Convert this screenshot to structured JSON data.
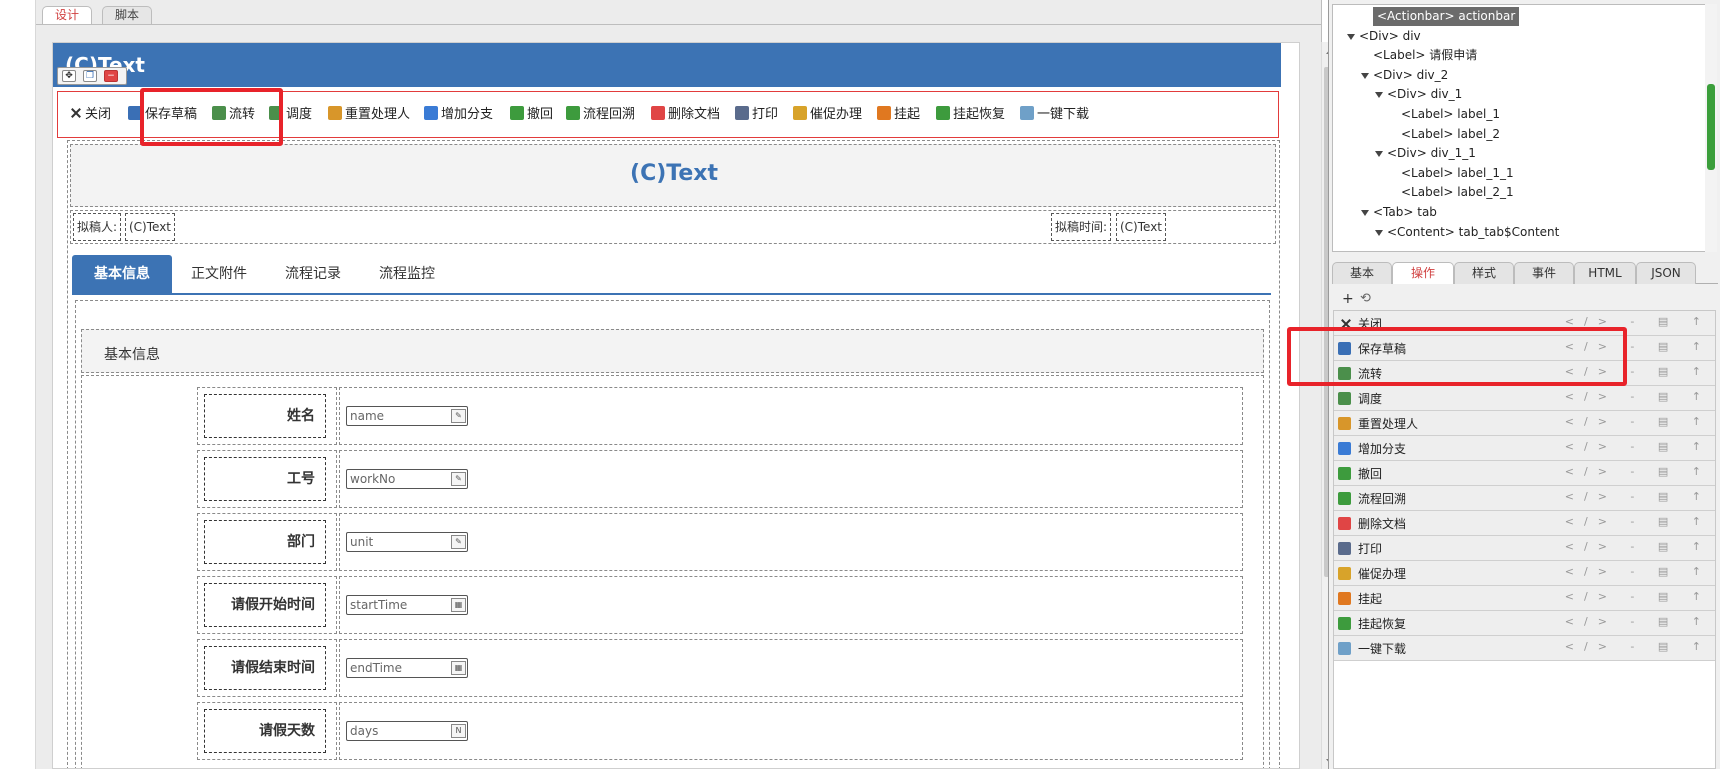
{
  "mode_tabs": {
    "design": "设计",
    "script": "脚本"
  },
  "form": {
    "title": "(C)Text",
    "header_text": "(C)Text",
    "drafter_label": "拟稿人:",
    "drafter_value": "(C)Text",
    "draft_time_label": "拟稿时间:",
    "draft_time_value": "(C)Text",
    "section_title": "基本信息"
  },
  "actionbar": {
    "items": [
      {
        "label": "关闭",
        "icon": "close-x",
        "color": "#333333"
      },
      {
        "label": "保存草稿",
        "icon": "save-draft",
        "color": "#3a6fb5"
      },
      {
        "label": "流转",
        "icon": "flow-transfer",
        "color": "#4b8f4b"
      },
      {
        "label": "调度",
        "icon": "dispatch",
        "color": "#4b8f4b"
      },
      {
        "label": "重置处理人",
        "icon": "reset-user",
        "color": "#d8962a"
      },
      {
        "label": "增加分支",
        "icon": "add-branch",
        "color": "#3a7bd5"
      },
      {
        "label": "撤回",
        "icon": "withdraw",
        "color": "#3d9b3d"
      },
      {
        "label": "流程回溯",
        "icon": "flow-trace",
        "color": "#3d9b3d"
      },
      {
        "label": "删除文档",
        "icon": "delete-doc",
        "color": "#e04545"
      },
      {
        "label": "打印",
        "icon": "print",
        "color": "#5a6b8c"
      },
      {
        "label": "催促办理",
        "icon": "urge",
        "color": "#d8a32a"
      },
      {
        "label": "挂起",
        "icon": "suspend",
        "color": "#e07820"
      },
      {
        "label": "挂起恢复",
        "icon": "resume",
        "color": "#3d9b3d"
      },
      {
        "label": "一键下载",
        "icon": "download",
        "color": "#6fa0c8"
      }
    ]
  },
  "form_tabs": [
    "基本信息",
    "正文附件",
    "流程记录",
    "流程监控"
  ],
  "fields": [
    {
      "label": "姓名",
      "value": "name",
      "btn": "edit"
    },
    {
      "label": "工号",
      "value": "workNo",
      "btn": "edit"
    },
    {
      "label": "部门",
      "value": "unit",
      "btn": "edit"
    },
    {
      "label": "请假开始时间",
      "value": "startTime",
      "btn": "calendar"
    },
    {
      "label": "请假结束时间",
      "value": "endTime",
      "btn": "calendar"
    },
    {
      "label": "请假天数",
      "value": "days",
      "btn": "number"
    }
  ],
  "tree": [
    {
      "text": "<Actionbar> actionbar",
      "level": 2,
      "arrow": false,
      "selected": true
    },
    {
      "text": "<Div> div",
      "level": 1,
      "arrow": true
    },
    {
      "text": "<Label> 请假申请",
      "level": 2,
      "arrow": false
    },
    {
      "text": "<Div> div_2",
      "level": 2,
      "arrow": true
    },
    {
      "text": "<Div> div_1",
      "level": 3,
      "arrow": true
    },
    {
      "text": "<Label> label_1",
      "level": 4,
      "arrow": false
    },
    {
      "text": "<Label> label_2",
      "level": 4,
      "arrow": false
    },
    {
      "text": "<Div> div_1_1",
      "level": 3,
      "arrow": true
    },
    {
      "text": "<Label> label_1_1",
      "level": 4,
      "arrow": false
    },
    {
      "text": "<Label> label_2_1",
      "level": 4,
      "arrow": false
    },
    {
      "text": "<Tab> tab",
      "level": 2,
      "arrow": true
    },
    {
      "text": "<Content> tab_tab$Content",
      "level": 3,
      "arrow": true
    }
  ],
  "inspector_tabs": [
    "基本",
    "操作",
    "样式",
    "事件",
    "HTML",
    "JSON"
  ],
  "ops_toolbar": {
    "add": "+",
    "history": "⟲"
  },
  "ops": [
    {
      "label": "关闭",
      "icon": "close-x",
      "color": "#333333"
    },
    {
      "label": "保存草稿",
      "icon": "save-draft",
      "color": "#3a6fb5"
    },
    {
      "label": "流转",
      "icon": "flow-transfer",
      "color": "#4b8f4b"
    },
    {
      "label": "调度",
      "icon": "dispatch",
      "color": "#4b8f4b"
    },
    {
      "label": "重置处理人",
      "icon": "reset-user",
      "color": "#d8962a"
    },
    {
      "label": "增加分支",
      "icon": "add-branch",
      "color": "#3a7bd5"
    },
    {
      "label": "撤回",
      "icon": "withdraw",
      "color": "#3d9b3d"
    },
    {
      "label": "流程回溯",
      "icon": "flow-trace",
      "color": "#3d9b3d"
    },
    {
      "label": "删除文档",
      "icon": "delete-doc",
      "color": "#e04545"
    },
    {
      "label": "打印",
      "icon": "print",
      "color": "#5a6b8c"
    },
    {
      "label": "催促办理",
      "icon": "urge",
      "color": "#d8a32a"
    },
    {
      "label": "挂起",
      "icon": "suspend",
      "color": "#e07820"
    },
    {
      "label": "挂起恢复",
      "icon": "resume",
      "color": "#3d9b3d"
    },
    {
      "label": "一键下载",
      "icon": "download",
      "color": "#6fa0c8"
    }
  ],
  "op_row_actions": "</> - ▤ ↑",
  "colors": {
    "accent": "#3c73b4",
    "highlight": "#e8232a"
  }
}
